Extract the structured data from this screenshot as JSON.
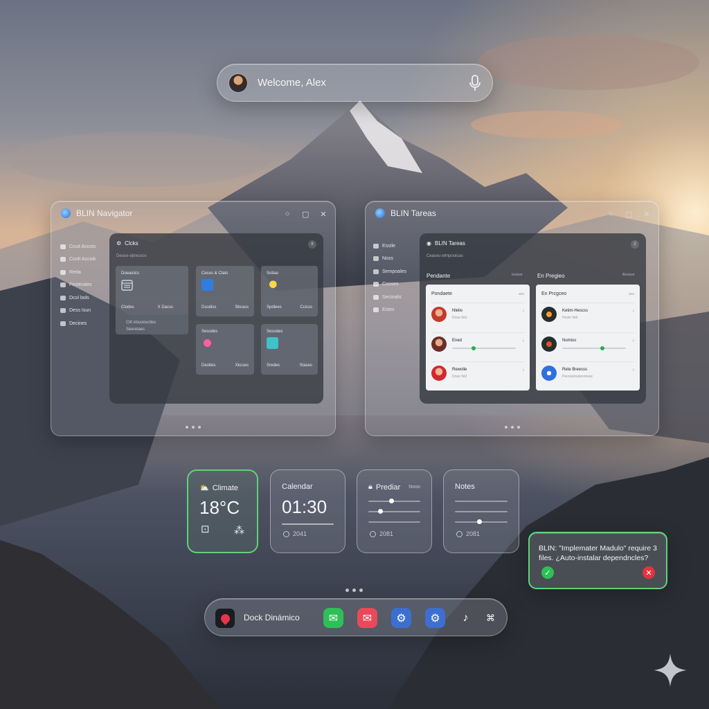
{
  "welcome": {
    "text": "Welcome, Alex"
  },
  "navigator": {
    "title": "BLIN Navigator",
    "sidebar": [
      "Ccuit Accois",
      "Coolt Acciok",
      "Reda",
      "Festerales",
      "Dcol bols",
      "Dess Isun",
      "Decines"
    ],
    "panel_title": "Clcks",
    "panel_sub": "Deoue ejtrecoos",
    "panel_badge": "8",
    "cards": [
      {
        "title": "Doeaiclcs",
        "left": "Clodes",
        "right": "X Dacss",
        "foot1": "Citl stsuoouclies",
        "foot2": "Seerelaes"
      },
      {
        "title": "Ceces & Ctats",
        "left": "Dsodiss",
        "right": "Sbcass"
      },
      {
        "title": "Sotiao",
        "left": "Spdlees",
        "right": "Ccicss"
      },
      {
        "title": "Sesodes",
        "left": "Deoltes",
        "right": "Xkcses"
      },
      {
        "title": "Sesodes",
        "left": "Sredes",
        "right": "Stases"
      }
    ]
  },
  "tasks": {
    "title": "BLIN Tareas",
    "sidebar": [
      "Esstle",
      "Noss",
      "Sempoales",
      "Cosses",
      "Secinalis",
      "Estes"
    ],
    "panel_title": "BLIN Tareas",
    "panel_sub": "Ceaceu elmpooicas",
    "panel_badge": "2",
    "col1": {
      "title": "Pendante",
      "tag": "Insisse",
      "list_head": "Pondaete",
      "list_tag": "ans"
    },
    "col2": {
      "title": "En Pregieo",
      "tag": "Besisse",
      "list_head": "En Prcgceo",
      "list_tag": "ans"
    },
    "col1_rows": [
      {
        "name": "Nlelio",
        "sub": "Doue fsld"
      },
      {
        "name": "Ened",
        "sub": ""
      },
      {
        "name": "Rewolle",
        "sub": "Doue fsld"
      }
    ],
    "col2_rows": [
      {
        "name": "Ketim-Hescss",
        "sub": "Hoste fsld"
      },
      {
        "name": "Nomios",
        "sub": ""
      },
      {
        "name": "Rete Breesss",
        "sub": "Peonsetoulenoneac"
      }
    ],
    "col1_progress": [
      0.3
    ],
    "col2_progress": [
      0.6
    ]
  },
  "widgets": {
    "climate": {
      "title": "Climate",
      "value": "18°C"
    },
    "calendar": {
      "title": "Calendar",
      "value": "01:30",
      "year": "2041"
    },
    "predict": {
      "title": "Prediar",
      "tag": "Nooo",
      "year": "2081"
    },
    "notes": {
      "title": "Notes",
      "year": "2081"
    }
  },
  "notification": {
    "message": "BLIN: \"Implemater Madulo\" require 3 files. ¿Auto-instalar dependncles?"
  },
  "dock": {
    "label": "Dock Dinámico",
    "apps": [
      "messages-icon",
      "mail-icon",
      "settings-icon",
      "preferences-icon",
      "music-icon",
      "gamepad-icon"
    ]
  },
  "colors": {
    "accent_green": "#5fd37a",
    "confirm": "#2fbf57",
    "cancel": "#e53340"
  }
}
